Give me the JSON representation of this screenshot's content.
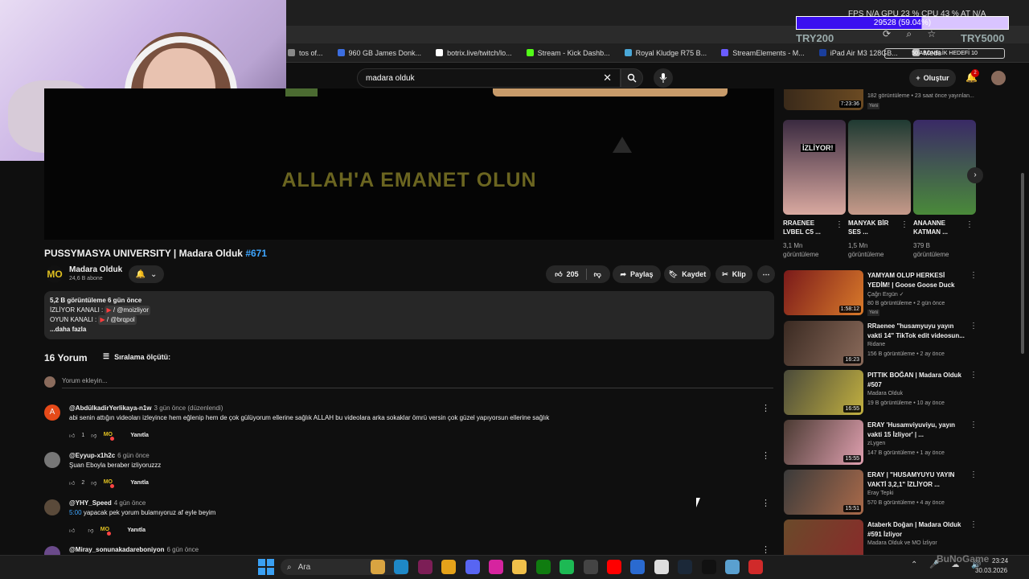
{
  "overlay": {
    "stats_text": "FPS N/A   GPU 23 %   CPU 43 %   AT N/A",
    "progress_text": "29528 (59.04%)",
    "progress_value": 0.5904,
    "try_left": "TRY200",
    "try_right": "TRY5000",
    "follower_goal": "50 ABONELİK HEDEFİ",
    "follower_goal_value": "10"
  },
  "bookmarks": [
    {
      "label": "tos of...",
      "color": "#888888"
    },
    {
      "label": "960 GB James Donk...",
      "color": "#3c6ee0"
    },
    {
      "label": "botrix.live/twitch/lo...",
      "color": "#ffffff"
    },
    {
      "label": "Stream - Kick Dashb...",
      "color": "#53fc18"
    },
    {
      "label": "Royal Kludge R75 B...",
      "color": "#4aa8d8"
    },
    {
      "label": "StreamElements - M...",
      "color": "#6a5cff"
    },
    {
      "label": "iPad Air M3 128GB...",
      "color": "#1a3e9c"
    },
    {
      "label": "Mede",
      "color": "#bbbbbb"
    }
  ],
  "header": {
    "search_query": "madara olduk",
    "create_label": "Oluştur",
    "notification_count": "2"
  },
  "video": {
    "overlay_text": "ALLAH'A EMANET OLUN",
    "title": "PUSSYMASYA UNIVERSITY | Madara Olduk",
    "title_tag": "#671",
    "channel_name": "Madara Olduk",
    "channel_logo": "MO",
    "subscribers": "24,6 B abone",
    "likes": "205",
    "share_label": "Paylaş",
    "save_label": "Kaydet",
    "clip_label": "Klip"
  },
  "description": {
    "stats": "5,2 B görüntüleme  6 gün önce",
    "line1_label": "İZLİYOR KANALI :",
    "line1_handle": "/ @moizliyor",
    "line2_label": "OYUN KANALI :",
    "line2_handle": "/ @brqpol",
    "more": "...daha fazla"
  },
  "comments_section": {
    "count": "16 Yorum",
    "sort_label": "Sıralama ölçütü:",
    "add_placeholder": "Yorum ekleyin...",
    "reply_label": "Yanıtla",
    "items": [
      {
        "avatar": "A",
        "avatar_color": "#e64a19",
        "user": "@AbdülkadirYerlikaya-n1w",
        "time": "3 gün önce (düzenlendi)",
        "timestamp": "",
        "text": "abi senin attığın videoları izleyince hem eğlenip hem de çok gülüyorum ellerine sağlık ALLAH bu videolara arka sokaklar ömrü versin çok güzel yapıyorsun ellerine sağlık",
        "likes": "1"
      },
      {
        "avatar": "",
        "avatar_color": "#777777",
        "user": "@Eyyup-x1h2c",
        "time": "6 gün önce",
        "timestamp": "",
        "text": "Şuan Eboyla beraber izliyoruzzz",
        "likes": "2"
      },
      {
        "avatar": "",
        "avatar_color": "#5a4a3a",
        "user": "@YHY_Speed",
        "time": "4 gün önce",
        "timestamp": "5:00",
        "text": "yapacak pek yorum bulamıyoruz af eyle beyim",
        "likes": ""
      },
      {
        "avatar": "",
        "avatar_color": "#6a4a8a",
        "user": "@Miray_sonunakadareboniyon",
        "time": "6 gün önce",
        "timestamp": "",
        "text": "",
        "likes": ""
      }
    ]
  },
  "sidebar": {
    "top_item": {
      "duration": "7:23:36",
      "meta": "182 görüntüleme • 23 saat önce yayınlan...",
      "badge": "Yeni"
    },
    "shorts": [
      {
        "title1": "RRAENEE",
        "title2": "LVBEL C5 ...",
        "views1": "3,1 Mn",
        "views2": "görüntüleme",
        "label": "İZLİYOR!",
        "color1": "#3a2a40",
        "color2": "#d9a9a0"
      },
      {
        "title1": "MANYAK BİR",
        "title2": "SES ...",
        "views1": "1,5 Mn",
        "views2": "görüntüleme",
        "label": "",
        "color1": "#1f3a32",
        "color2": "#c69a8a"
      },
      {
        "title1": "ANAANNE",
        "title2": "KATMAN ...",
        "views1": "379 B",
        "views2": "görüntüleme",
        "label": "",
        "color1": "#3a2a66",
        "color2": "#4a8a3a"
      }
    ],
    "videos": [
      {
        "title": "YAMYAM OLUP HERKESİ YEDİM! | Goose Goose Duck",
        "channel": "Çağrı Ergün ✓",
        "meta": "80 B görüntüleme • 2 gün önce",
        "duration": "1:58:12",
        "badge": "Yeni",
        "color1": "#7a1a1a",
        "color2": "#d97a2a"
      },
      {
        "title": "RRaenee \"husamyuyu yayın vakti 14\" TikTok edit videosun...",
        "channel": "Ridane",
        "meta": "156 B görüntüleme • 2 ay önce",
        "duration": "16:23",
        "badge": "",
        "color1": "#3a2a22",
        "color2": "#8a6a5a"
      },
      {
        "title": "PITTIK BOĞAN | Madara Olduk #507",
        "channel": "Madara Olduk",
        "meta": "19 B görüntüleme • 10 ay önce",
        "duration": "16:55",
        "badge": "",
        "color1": "#4a4a3a",
        "color2": "#c2b040"
      },
      {
        "title": "ERAY 'Husamviyuviyu, yayın vakti 15 İzliyor' | ...",
        "channel": "zLygen",
        "meta": "147 B görüntüleme • 1 ay önce",
        "duration": "15:55",
        "badge": "",
        "color1": "#4a3a32",
        "color2": "#e0a0b0"
      },
      {
        "title": "ERAY | \"HUSAMYUYU YAYIN VAKTİ 3,2,1\" İZLİYOR ...",
        "channel": "Eray Tepki",
        "meta": "570 B görüntüleme • 4 ay önce",
        "duration": "15:51",
        "badge": "",
        "color1": "#3a3a3a",
        "color2": "#aa6a4a"
      },
      {
        "title": "Ataberk Doğan | Madara Olduk #591 İzliyor",
        "channel": "Madara Olduk ve MO İzliyor",
        "meta": "",
        "duration": "",
        "badge": "",
        "color1": "#6a4a2a",
        "color2": "#8a2a2a"
      }
    ]
  },
  "taskbar": {
    "search_label": "Ara",
    "time": "23:24",
    "date": "30.03.2026",
    "watermark": "BuNoGame",
    "apps": [
      {
        "name": "explorer-app",
        "color": "#d9a441"
      },
      {
        "name": "edge-app",
        "color": "#1e88c7"
      },
      {
        "name": "vs-app",
        "color": "#7c1e56"
      },
      {
        "name": "chrome-app",
        "color": "#e5a21a"
      },
      {
        "name": "discord-app",
        "color": "#5865f2"
      },
      {
        "name": "instagram-app",
        "color": "#d6249f"
      },
      {
        "name": "files-app",
        "color": "#f0c04a"
      },
      {
        "name": "xbox-app",
        "color": "#107c10"
      },
      {
        "name": "spotify-app",
        "color": "#1db954"
      },
      {
        "name": "obs-app",
        "color": "#444444"
      },
      {
        "name": "youtube-app",
        "color": "#ff0000"
      },
      {
        "name": "mail-app",
        "color": "#2a6ad0"
      },
      {
        "name": "notes-app",
        "color": "#dddddd"
      },
      {
        "name": "steam-app",
        "color": "#1b2838"
      },
      {
        "name": "tiktok-app",
        "color": "#111111"
      },
      {
        "name": "settings-app",
        "color": "#5aa0d0"
      },
      {
        "name": "recorder-app",
        "color": "#d02a2a"
      }
    ]
  }
}
